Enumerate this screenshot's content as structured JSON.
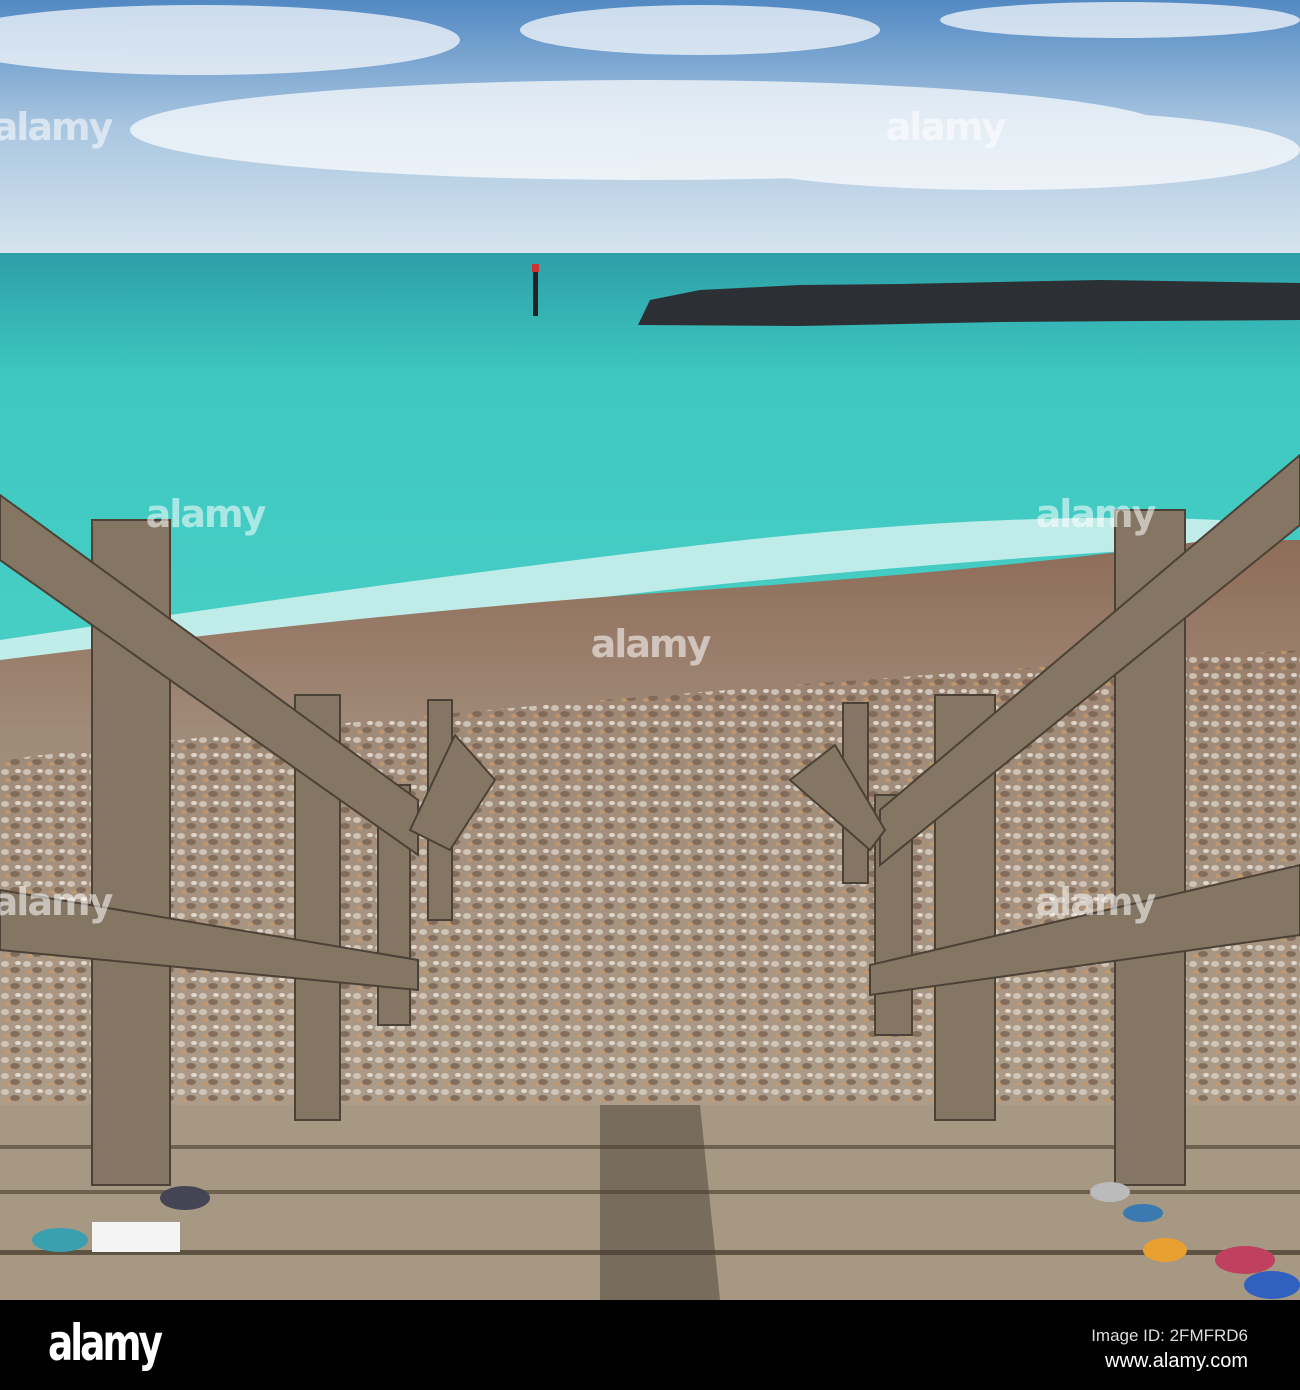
{
  "photo": {
    "subject": "wooden steps down to a shingle beach and turquoise sea"
  },
  "watermark": {
    "text": "alamy"
  },
  "footer": {
    "logo": "alamy",
    "image_id": "Image ID: 2FMFRD6",
    "website": "www.alamy.com"
  },
  "colors": {
    "sky": "#5f93c8",
    "sea": "#3ec8c0",
    "beach": "#9c8470",
    "wood": "#8a7a66"
  }
}
